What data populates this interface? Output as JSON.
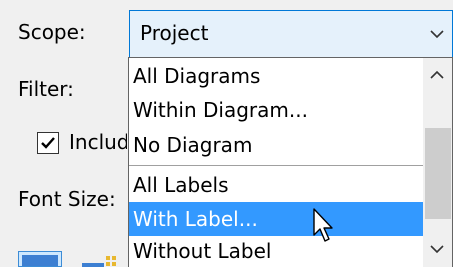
{
  "labels": {
    "scope": "Scope:",
    "filter": "Filter:",
    "include": "Includ",
    "font_size": "Font Size:"
  },
  "scope_combo": {
    "value": "Project",
    "arrow_icon": "chevron-down-icon"
  },
  "dropdown": {
    "items": [
      {
        "label": "All Diagrams"
      },
      {
        "label": "Within Diagram..."
      },
      {
        "label": "No Diagram"
      },
      {
        "label": "All Labels"
      },
      {
        "label": "With Label...",
        "selected": true
      },
      {
        "label": "Without Label"
      }
    ]
  },
  "include_checkbox": {
    "checked": true
  },
  "colors": {
    "selection": "#3399ff",
    "combo_border": "#0078d7",
    "combo_bg": "#e5f1fb"
  }
}
